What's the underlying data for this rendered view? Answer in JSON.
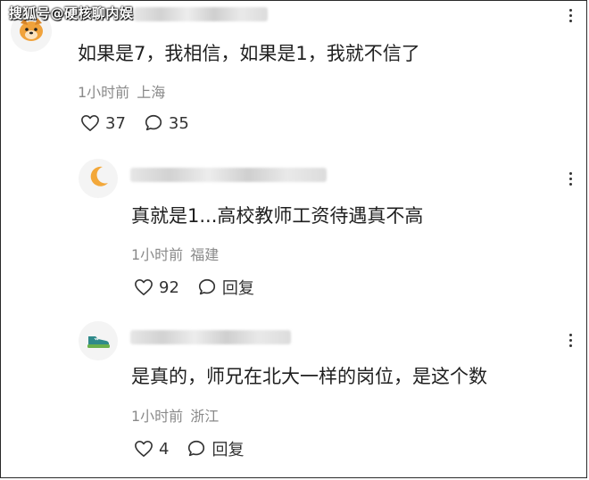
{
  "watermark": "搜狐号@硬核聊内娱",
  "comments": [
    {
      "text": "如果是7，我相信，如果是1，我就不信了",
      "time": "1小时前",
      "location": "上海",
      "likes": "37",
      "replies": "35",
      "avatar_icon": "dog-face-icon"
    },
    {
      "text": "真就是1...高校教师工资待遇真不高",
      "time": "1小时前",
      "location": "福建",
      "likes": "92",
      "reply_label": "回复",
      "avatar_icon": "moon-icon"
    },
    {
      "text": "是真的，师兄在北大一样的岗位，是这个数",
      "time": "1小时前",
      "location": "浙江",
      "likes": "4",
      "reply_label": "回复",
      "avatar_icon": "sneaker-icon"
    }
  ],
  "colors": {
    "dog": "#f0a23b",
    "moon": "#f3a83a",
    "sneaker_body": "#2f8a8a",
    "sneaker_sole": "#6ab04c"
  }
}
